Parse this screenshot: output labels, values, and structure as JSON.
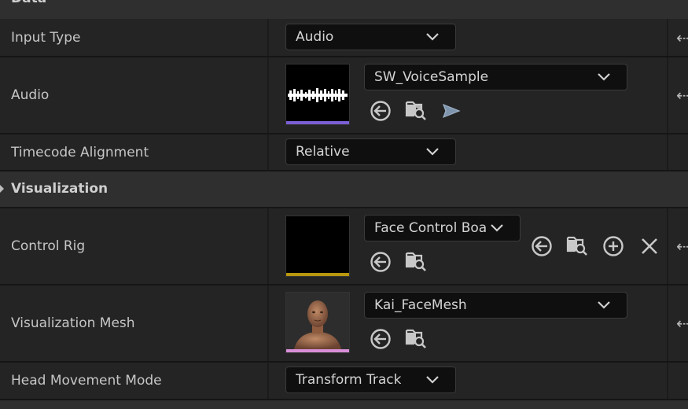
{
  "sections": {
    "data": {
      "title": "Data"
    },
    "visualization": {
      "title": "Visualization"
    }
  },
  "rows": {
    "input_type": {
      "label": "Input Type",
      "value": "Audio"
    },
    "audio": {
      "label": "Audio",
      "asset": "SW_VoiceSample",
      "thumb_bar_color": "#7b5fd6"
    },
    "timecode": {
      "label": "Timecode Alignment",
      "value": "Relative"
    },
    "control_rig": {
      "label": "Control Rig",
      "asset": "Face Control Boa",
      "thumb_bar_color": "#b8960e"
    },
    "vis_mesh": {
      "label": "Visualization Mesh",
      "asset": "Kai_FaceMesh",
      "thumb_bar_color": "#d98fd8"
    },
    "head_movement": {
      "label": "Head Movement Mode",
      "value": "Transform Track"
    }
  },
  "icons": {
    "reset": "reset-arrow-icon",
    "use_selected": "use-selected-asset-icon",
    "browse": "browse-to-asset-icon",
    "play": "play-audio-icon",
    "add": "add-icon",
    "clear": "clear-icon",
    "chevron": "chevron-down-icon"
  },
  "colors": {
    "background": "#1a1a1a",
    "row": "#242424",
    "section": "#2f2f2f",
    "field": "#0f0f0f"
  }
}
